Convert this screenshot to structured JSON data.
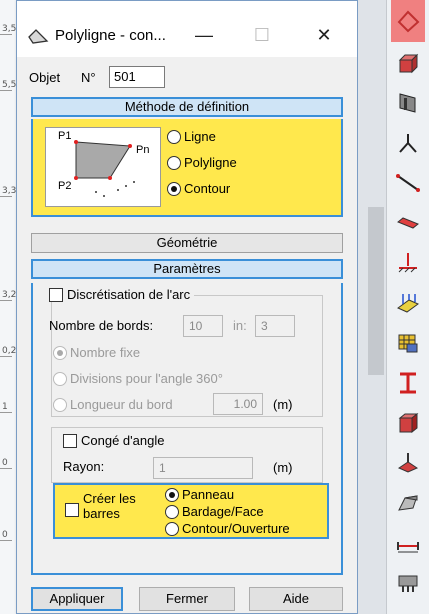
{
  "ruler": {
    "ticks": [
      "3,5",
      "5,5",
      "3,3",
      "3,2",
      "0,2",
      "1",
      "0",
      "0"
    ]
  },
  "dialog": {
    "title": "Polyligne - con...",
    "objet_label": "Objet",
    "numero_label": "N°",
    "numero_value": "501",
    "methode_header": "Méthode de définition",
    "diagram_labels": {
      "p1": "P1",
      "pn": "Pn",
      "p2": "P2"
    },
    "methode_options": [
      {
        "label": "Ligne",
        "checked": false
      },
      {
        "label": "Polyligne",
        "checked": false
      },
      {
        "label": "Contour",
        "checked": true
      }
    ],
    "geometrie_header": "Géométrie",
    "parametres_header": "Paramètres",
    "discretisation": {
      "checkbox_label": "Discrétisation de l'arc",
      "checked": false,
      "nombre_bords_label": "Nombre de bords:",
      "nombre_bords_value": "10",
      "min_label": "in:",
      "min_value": "3",
      "options": [
        {
          "label": "Nombre fixe",
          "checked": true
        },
        {
          "label": "Divisions pour l'angle 360°",
          "checked": false
        },
        {
          "label": "Longueur du bord",
          "checked": false
        }
      ],
      "longueur_value": "1.00",
      "longueur_unit": "(m)"
    },
    "conge": {
      "checkbox_label": "Congé d'angle",
      "checked": false,
      "rayon_label": "Rayon:",
      "rayon_value": "1",
      "rayon_unit": "(m)"
    },
    "barres": {
      "checkbox_label_1": "Créer les",
      "checkbox_label_2": "barres",
      "checked": false,
      "options": [
        {
          "label": "Panneau",
          "checked": true
        },
        {
          "label": "Bardage/Face",
          "checked": false
        },
        {
          "label": "Contour/Ouverture",
          "checked": false
        }
      ]
    },
    "buttons": {
      "apply": "Appliquer",
      "close": "Fermer",
      "help": "Aide"
    }
  },
  "toolbar": {
    "tools": [
      "shape-icon",
      "volume-icon",
      "panel-icon",
      "branch-icon",
      "line-icon",
      "beam-icon",
      "support-icon",
      "load-icon",
      "grid-icon",
      "i-beam-icon",
      "section-icon",
      "foundation-icon",
      "solid-icon",
      "dimension-icon",
      "misc-icon"
    ],
    "active_color": "#f08080"
  }
}
